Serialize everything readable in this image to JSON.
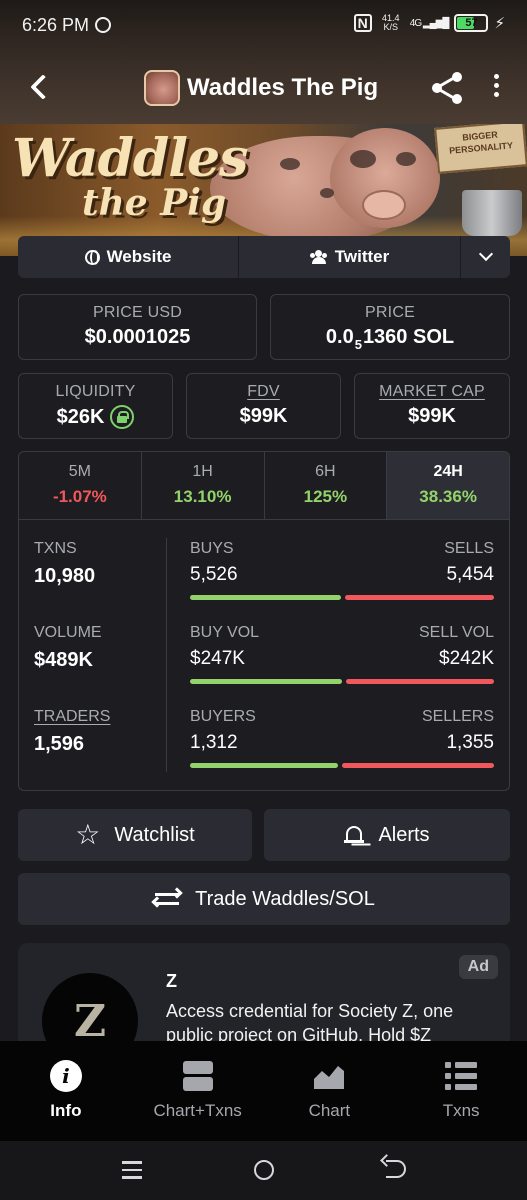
{
  "status_bar": {
    "time": "6:26 PM",
    "net_speed_value": "41.4",
    "net_speed_unit": "K/S",
    "network": "4G",
    "battery": "57"
  },
  "header": {
    "title": "Waddles The Pig"
  },
  "banner": {
    "title_line1": "Waddles",
    "title_line2": "the Pig",
    "sign_text": "BIGGER PERSONALITY"
  },
  "links": {
    "website": "Website",
    "twitter": "Twitter"
  },
  "price": {
    "usd_label": "PRICE USD",
    "usd_value": "$0.0001025",
    "sol_label": "PRICE",
    "sol_prefix": "0.0",
    "sol_subscript": "5",
    "sol_suffix": "1360 SOL"
  },
  "market": {
    "liquidity_label": "LIQUIDITY",
    "liquidity_value": "$26K",
    "fdv_label": "FDV",
    "fdv_value": "$99K",
    "mcap_label": "MARKET CAP",
    "mcap_value": "$99K"
  },
  "periods": [
    {
      "label": "5M",
      "value": "-1.07%",
      "trend": "neg"
    },
    {
      "label": "1H",
      "value": "13.10%",
      "trend": "pos"
    },
    {
      "label": "6H",
      "value": "125%",
      "trend": "pos"
    },
    {
      "label": "24H",
      "value": "38.36%",
      "trend": "pos",
      "active": true
    }
  ],
  "stats": {
    "txns_label": "TXNS",
    "txns_value": "10,980",
    "volume_label": "VOLUME",
    "volume_value": "$489K",
    "traders_label": "TRADERS",
    "traders_value": "1,596",
    "buys_label": "BUYS",
    "buys_value": "5,526",
    "sells_label": "SELLS",
    "sells_value": "5,454",
    "buy_vol_label": "BUY VOL",
    "buy_vol_value": "$247K",
    "sell_vol_label": "SELL VOL",
    "sell_vol_value": "$242K",
    "buyers_label": "BUYERS",
    "buyers_value": "1,312",
    "sellers_label": "SELLERS",
    "sellers_value": "1,355"
  },
  "actions": {
    "watchlist": "Watchlist",
    "alerts": "Alerts",
    "trade": "Trade Waddles/SOL"
  },
  "ad": {
    "badge": "Ad",
    "name": "Z",
    "logo_letter": "Z",
    "text": "Access credential for Society Z, one public project on GitHub. Hold $Z"
  },
  "bottom_nav": [
    {
      "label": "Info",
      "active": true
    },
    {
      "label": "Chart+Txns"
    },
    {
      "label": "Chart"
    },
    {
      "label": "Txns"
    }
  ],
  "colors": {
    "positive": "#94d36b",
    "negative": "#f0585c",
    "background": "#1b1b1f"
  }
}
